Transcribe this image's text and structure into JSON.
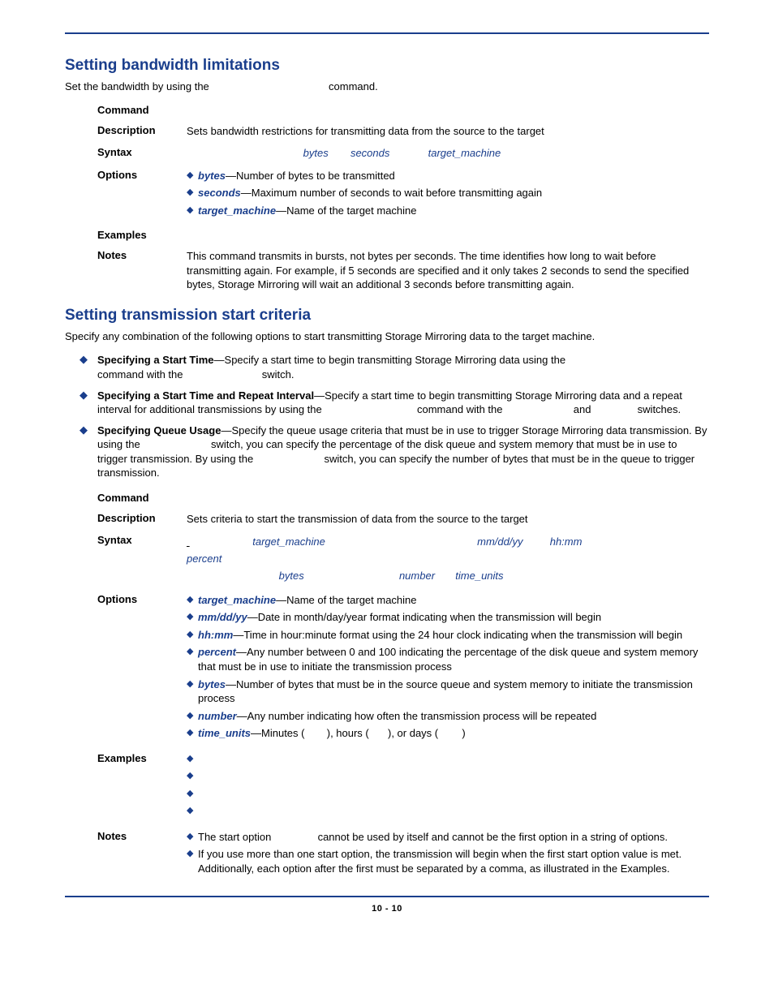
{
  "footer": "10 - 10",
  "sec1": {
    "heading": "Setting bandwidth limitations",
    "intro_pre": "Set the bandwidth by using the ",
    "intro_post": " command.",
    "command_label": "Command",
    "desc_label": "Description",
    "desc_text": "Sets bandwidth restrictions for transmitting data from the source to the target",
    "syntax_label": "Syntax",
    "syntax_p1": "bytes",
    "syntax_p2": "seconds",
    "syntax_p3": "target_machine",
    "options_label": "Options",
    "opt1_name": "bytes",
    "opt1_text": "—Number of bytes to be transmitted",
    "opt2_name": "seconds",
    "opt2_text": "—Maximum number of seconds to wait before transmitting again",
    "opt3_name": "target_machine",
    "opt3_text": "—Name of the target machine",
    "examples_label": "Examples",
    "notes_label": "Notes",
    "notes_text": "This command transmits in bursts, not bytes per seconds. The time identifies how long to wait before transmitting again. For example, if 5 seconds are specified and it only takes 2 seconds to send the specified bytes, Storage Mirroring will wait an additional 3 seconds before transmitting again."
  },
  "sec2": {
    "heading": "Setting transmission start criteria",
    "intro": "Specify any combination of the following options to start transmitting Storage Mirroring data to the target machine.",
    "b1_title": "Specifying a Start Time",
    "b1_t1": "—Specify a start time to begin transmitting Storage Mirroring data using the ",
    "b1_t2": "command with the ",
    "b1_t3": " switch.",
    "b2_title": "Specifying a Start Time and Repeat Interval",
    "b2_t1": "—Specify a start time to begin transmitting Storage Mirroring data and a repeat interval for additional transmissions by using the ",
    "b2_t2": " command with the ",
    "b2_t3": " and ",
    "b2_t4": " switches.",
    "b3_title": "Specifying Queue Usage",
    "b3_t1": "—Specify the queue usage criteria that must be in use to trigger Storage Mirroring data transmission. By using the ",
    "b3_t2": " switch, you can specify the percentage of the disk queue and system memory that must be in use to trigger transmission. By using the ",
    "b3_t3": " switch, you can specify the number of bytes that must be in the queue to trigger transmission.",
    "command_label": "Command",
    "desc_label": "Description",
    "desc_text": "Sets criteria to start the transmission of data from the source to the target",
    "syntax_label": "Syntax",
    "syn_p1": "target_machine",
    "syn_p2": "mm/dd/yy",
    "syn_p3": "hh:mm",
    "syn_p4": "percent",
    "syn_p5": "bytes",
    "syn_p6": "number",
    "syn_p7": "time_units",
    "options_label": "Options",
    "o1n": "target_machine",
    "o1t": "—Name of the target machine",
    "o2n": "mm/dd/yy",
    "o2t": "—Date in month/day/year format indicating when the transmission will begin",
    "o3n": "hh:mm",
    "o3t": "—Time in hour:minute format using the 24 hour clock indicating when the transmission will begin",
    "o4n": "percent",
    "o4t": "—Any number between 0 and 100 indicating the percentage of the disk queue and system memory that must be in use to initiate the transmission process",
    "o5n": "bytes",
    "o5t": "—Number of bytes that must be in the source queue and system memory to initiate the transmission process",
    "o6n": "number",
    "o6t": "—Any number indicating how often the transmission process will be repeated",
    "o7n": "time_units",
    "o7pre": "—Minutes (",
    "o7mid1": "), hours (",
    "o7mid2": "), or days (",
    "o7end": ")",
    "examples_label": "Examples",
    "notes_label": "Notes",
    "n1_pre": "The start option ",
    "n1_post": " cannot be used by itself and cannot be the first option in a string of options.",
    "n2": "If you use more than one start option, the transmission will begin when the first start option value is met. Additionally, each option after the first must be separated by a comma, as illustrated in the Examples."
  }
}
